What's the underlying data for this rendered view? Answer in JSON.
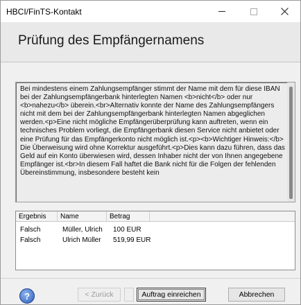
{
  "window": {
    "title": "HBCI/FinTS-Kontakt"
  },
  "header": {
    "heading": "Prüfung des Empfängernamens"
  },
  "info_text": "Bei mindestens einem Zahlungsempfänger stimmt der Name mit dem für diese IBAN bei der Zahlungsempfängerbank hinterlegten Namen <b>nicht</b> oder nur <b>nahezu</b> überein.<br>Alternativ konnte der Name des Zahlungsempfängers nicht mit dem bei der Zahlungsempfängerbank hinterlegten Namen abgeglichen werden.<p>Eine nicht mögliche Empfängerüberprüfung kann auftreten, wenn ein technisches Problem vorliegt, die Empfängerbank diesen Service nicht anbietet oder eine Prüfung für das Empfängerkonto nicht möglich ist.<p><b>Wichtiger Hinweis:</b> Die Überweisung wird ohne Korrektur ausgeführt.<p>Dies kann dazu führen, dass das Geld auf ein Konto überwiesen wird, dessen Inhaber nicht der von Ihnen angegebene Empfänger ist.<br>In diesem Fall haftet die Bank nicht für die Folgen der fehlenden Übereinstimmung, insbesondere besteht kein",
  "table": {
    "columns": [
      "Ergebnis",
      "Name",
      "Betrag"
    ],
    "rows": [
      {
        "ergebnis": "Falsch",
        "name": "Müller, Ulrich",
        "betrag": "100 EUR"
      },
      {
        "ergebnis": "Falsch",
        "name": "Ulrich Müller",
        "betrag": "519,99 EUR"
      }
    ]
  },
  "footer": {
    "help_label": "?",
    "back_label": "< Zurück",
    "submit_label": "Auftrag einreichen",
    "cancel_label": "Abbrechen"
  },
  "colors": {
    "accent": "#2b5fbf",
    "window_bg": "#f0f0f0"
  }
}
